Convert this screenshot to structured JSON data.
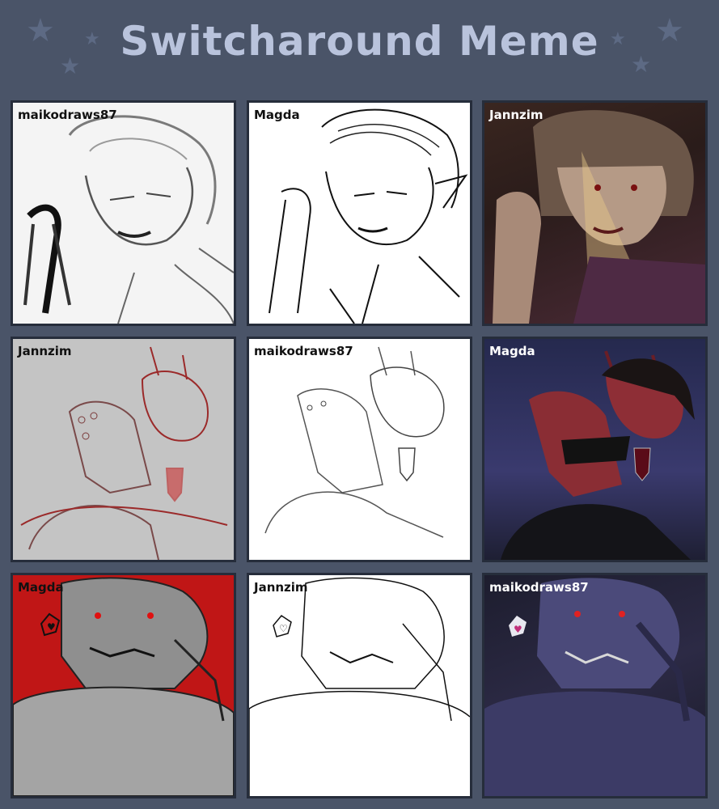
{
  "title": "Switcharound Meme",
  "panels": [
    {
      "artist": "maikodraws87",
      "style": "sketch",
      "subject": "vampire elf biting fingernail"
    },
    {
      "artist": "Magda",
      "style": "lineart",
      "subject": "vampire elf biting fingernail"
    },
    {
      "artist": "Jannzim",
      "style": "painted",
      "subject": "vampire elf biting fingernail"
    },
    {
      "artist": "Jannzim",
      "style": "sketch",
      "subject": "tiefling woman with wine glass"
    },
    {
      "artist": "maikodraws87",
      "style": "lineart",
      "subject": "tiefling woman with wine glass"
    },
    {
      "artist": "Magda",
      "style": "painted",
      "subject": "tiefling woman with wine glass"
    },
    {
      "artist": "Magda",
      "style": "sketch",
      "subject": "dragonborn with heart"
    },
    {
      "artist": "Jannzim",
      "style": "lineart",
      "subject": "dragonborn with heart"
    },
    {
      "artist": "maikodraws87",
      "style": "painted",
      "subject": "dragonborn with heart"
    }
  ],
  "colors": {
    "background": "#4a5468",
    "title": "#b9c3dc",
    "star": "#5d6a84",
    "panel_border": "#262d3b"
  }
}
